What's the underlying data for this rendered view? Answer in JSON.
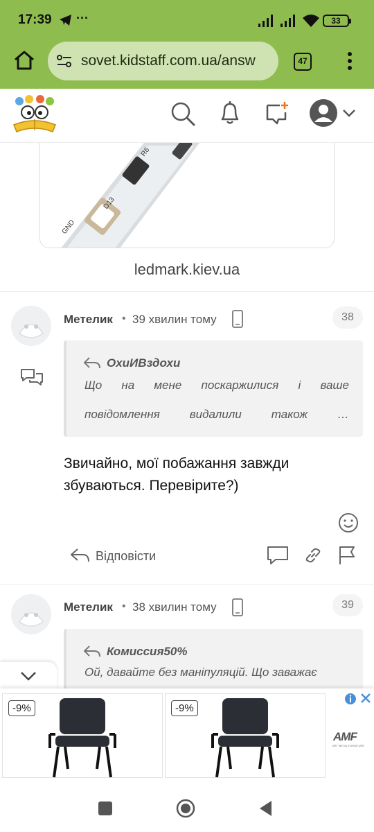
{
  "status_bar": {
    "time": "17:39",
    "battery": "33"
  },
  "browser": {
    "url": "sovet.kidstaff.com.ua/answ",
    "tab_count": "47"
  },
  "image_block": {
    "caption": "ledmark.kiev.ua"
  },
  "posts": [
    {
      "author": "Метелик",
      "time": "39 хвилин тому",
      "number": "38",
      "quote_author": "ОхиИВздохи",
      "quote_line1": "Що на мене поскаржилися і ваше",
      "quote_line2": "повідомлення видалили також …",
      "body_line1": "Звичайно, мої побажання завжди",
      "body_line2": "збуваються. Перевірите?)",
      "reply_label": "Відповісти"
    },
    {
      "author": "Метелик",
      "time": "38 хвилин тому",
      "number": "39",
      "quote_author": "Комиссия50%",
      "quote_line1": "Ой, давайте без маніпуляцій. Що заважає"
    }
  ],
  "ads": [
    {
      "discount": "-9%"
    },
    {
      "discount": "-9%"
    }
  ],
  "ad_brand": "AMF",
  "ad_brand_sub": "ART METAL FURNITURE",
  "colors": {
    "accent_green": "#8fbc4f",
    "url_box": "#cfe3b2"
  }
}
